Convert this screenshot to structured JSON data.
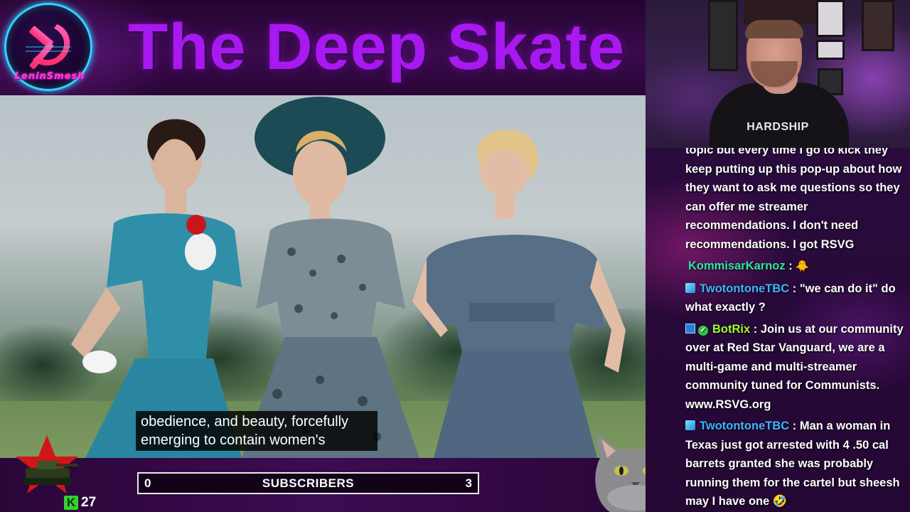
{
  "header": {
    "title": "The Deep Skate",
    "logo_text": "LeninSmesh"
  },
  "video": {
    "subtitle_lines": [
      "obedience, and beauty, forcefully",
      "emerging to contain women's"
    ]
  },
  "bottom_bar": {
    "kill_badge": "K",
    "kill_count": "27",
    "subscriber_goal": {
      "current": "0",
      "label": "SUBSCRIBERS",
      "target": "3"
    }
  },
  "webcam": {
    "shirt_text": "HARDSHIP"
  },
  "chat": {
    "messages": [
      {
        "user": "",
        "text": "topic but every time I go to kick they keep putting up this pop-up about how they want to ask me questions so they can offer me streamer recommendations. I don't need recommendations. I got RSVG"
      },
      {
        "user": "KommisarKarnoz",
        "sep": " :",
        "text": "🐥"
      },
      {
        "user": "TwotontoneTBC",
        "sep": " :",
        "text": "\"we can do it\" do what exactly ?"
      },
      {
        "user": "BotRix",
        "sep": " :",
        "text": "Join us at our community over at Red Star Vanguard, we are a multi-game and multi-streamer community tuned for Communists. www.RSVG.org"
      },
      {
        "user": "TwotontoneTBC",
        "sep": " :",
        "text": "Man a woman in Texas just got arrested with 4 .50 cal barrets granted she was probably running them for the cartel but sheesh may I have one 🤣"
      }
    ]
  },
  "colors": {
    "title": "#a818f0",
    "logo_ring": "#2fd3ff",
    "user_green": "#2ee6a6",
    "user_blue": "#3ab6ff",
    "user_botrix": "#9cff2e",
    "kill_badge": "#34d12f"
  },
  "icons": [
    "hammer-sickle-icon",
    "star-tank-icon",
    "kill-k-icon",
    "cube-badge-icon",
    "check-badge-icon",
    "duck-emote-icon",
    "laugh-emote-icon",
    "cat-overlay"
  ]
}
